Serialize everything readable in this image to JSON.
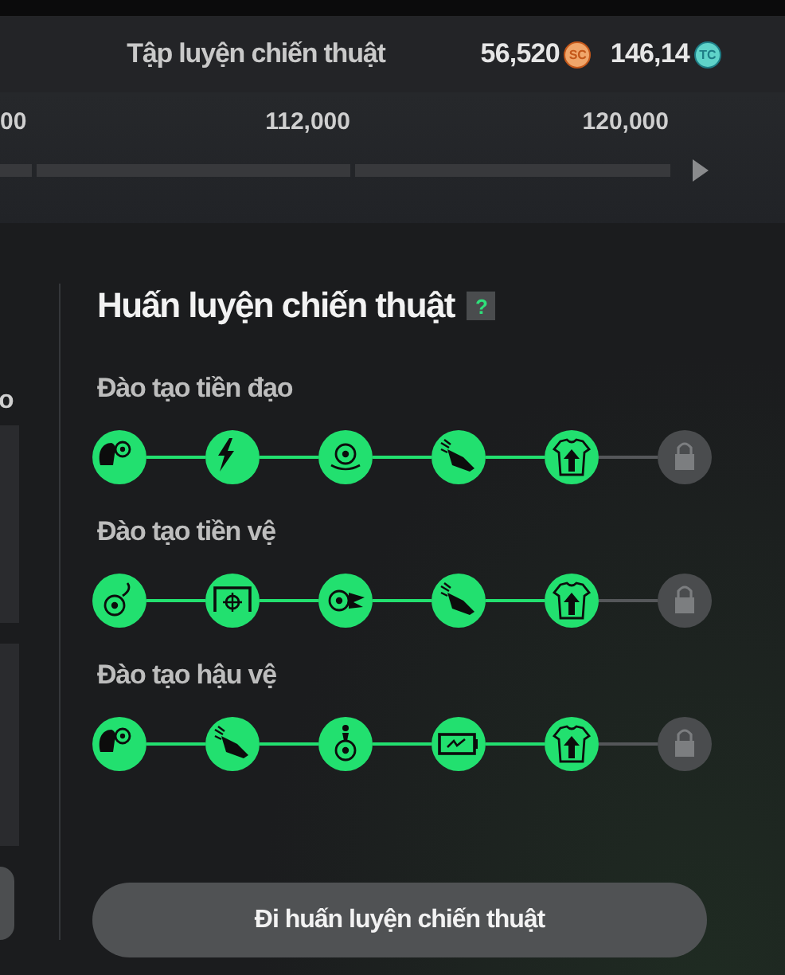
{
  "header": {
    "title": "Tập luyện chiến thuật",
    "currencies": [
      {
        "amount": "56,520",
        "kind": "sc",
        "icon_label": "SC"
      },
      {
        "amount": "146,14",
        "kind": "tc",
        "icon_label": "TC"
      }
    ]
  },
  "progress": {
    "ticks": [
      "00",
      "112,000",
      "120,000"
    ]
  },
  "left_panel": {
    "label_fragment": "o"
  },
  "training": {
    "title": "Huấn luyện chiến thuật",
    "help": "?",
    "tracks": [
      {
        "label": "Đào tạo tiền đạo",
        "nodes": [
          {
            "kind": "header",
            "unlocked": true
          },
          {
            "kind": "bolt",
            "unlocked": true
          },
          {
            "kind": "ball-swirl",
            "unlocked": true
          },
          {
            "kind": "boot",
            "unlocked": true
          },
          {
            "kind": "shirt-up",
            "unlocked": true
          },
          {
            "kind": "lock",
            "unlocked": false
          }
        ]
      },
      {
        "label": "Đào tạo tiền vệ",
        "nodes": [
          {
            "kind": "ball-curve",
            "unlocked": true
          },
          {
            "kind": "goal-target",
            "unlocked": true
          },
          {
            "kind": "ball-wing",
            "unlocked": true
          },
          {
            "kind": "boot",
            "unlocked": true
          },
          {
            "kind": "shirt-up",
            "unlocked": true
          },
          {
            "kind": "lock",
            "unlocked": false
          }
        ]
      },
      {
        "label": "Đào tạo hậu vệ",
        "nodes": [
          {
            "kind": "header",
            "unlocked": true
          },
          {
            "kind": "boot",
            "unlocked": true
          },
          {
            "kind": "ball-player",
            "unlocked": true
          },
          {
            "kind": "battery",
            "unlocked": true
          },
          {
            "kind": "shirt-up",
            "unlocked": true
          },
          {
            "kind": "lock",
            "unlocked": false
          }
        ]
      }
    ]
  },
  "action_button": "Đi huấn luyện chiến thuật"
}
